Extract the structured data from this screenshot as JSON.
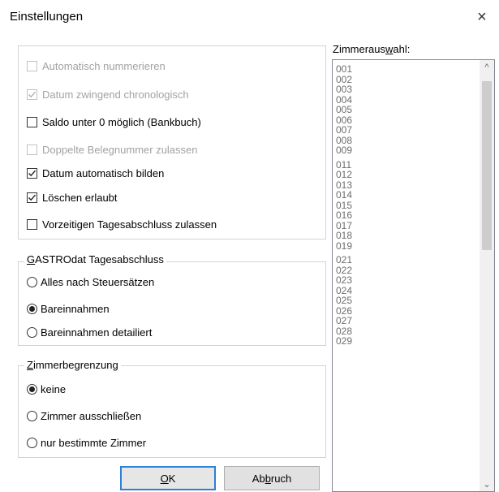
{
  "window": {
    "title": "Einstellungen",
    "close_glyph": "×"
  },
  "options": [
    {
      "label": "Automatisch nummerieren",
      "checked": false,
      "disabled": true
    },
    {
      "label": "Datum zwingend chronologisch",
      "checked": true,
      "disabled": true
    },
    {
      "label": "Saldo unter 0 möglich (Bankbuch)",
      "checked": false,
      "disabled": false
    },
    {
      "label": "Doppelte Belegnummer zulassen",
      "checked": false,
      "disabled": true
    },
    {
      "label": "Datum automatisch bilden",
      "checked": true,
      "disabled": false
    },
    {
      "label": "Löschen erlaubt",
      "checked": true,
      "disabled": false
    },
    {
      "label": "Vorzeitigen Tagesabschluss zulassen",
      "checked": false,
      "disabled": false
    }
  ],
  "gastro": {
    "title_pre": "G",
    "title_rest": "ASTROdat Tagesabschluss",
    "items": [
      {
        "label": "Alles nach Steuersätzen",
        "selected": false
      },
      {
        "label": "Bareinnahmen",
        "selected": true
      },
      {
        "label": "Bareinnahmen detailiert",
        "selected": false
      }
    ]
  },
  "zimmer": {
    "title_pre": "Z",
    "title_rest": "immerbegrenzung",
    "items": [
      {
        "label": "keine",
        "selected": true
      },
      {
        "label": "Zimmer ausschließen",
        "selected": false
      },
      {
        "label": "nur bestimmte Zimmer",
        "selected": false
      }
    ]
  },
  "buttons": {
    "ok_pre": "",
    "ok_u": "O",
    "ok_post": "K",
    "cancel_pre": "Ab",
    "cancel_u": "b",
    "cancel_post": "ruch"
  },
  "room_list": {
    "label_pre": "Zimmeraus",
    "label_u": "w",
    "label_post": "ahl:",
    "items": [
      "001",
      "002",
      "003",
      "004",
      "005",
      "006",
      "007",
      "008",
      "009",
      "",
      "011",
      "012",
      "013",
      "014",
      "015",
      "016",
      "017",
      "018",
      "019",
      "",
      "021",
      "022",
      "023",
      "024",
      "025",
      "026",
      "027",
      "028",
      "029"
    ],
    "scroll_up": "^",
    "scroll_down": "⌄"
  }
}
